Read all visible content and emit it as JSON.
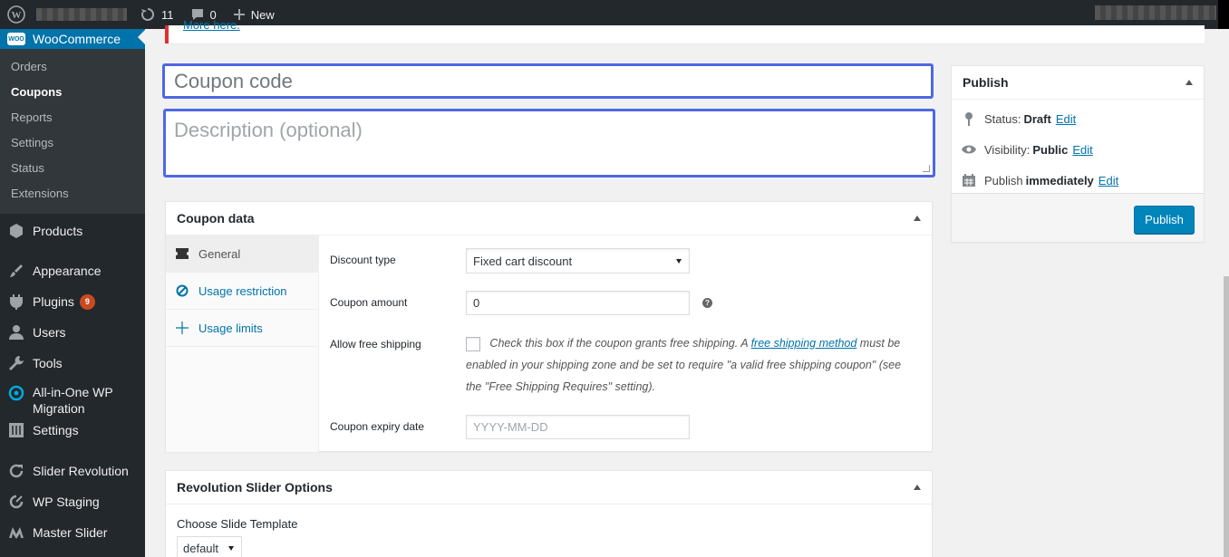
{
  "adminbar": {
    "updates_count": "11",
    "comments_count": "0",
    "new_label": "New"
  },
  "sidebar": {
    "woocommerce_label": "WooCommerce",
    "woo_badge": "WOO",
    "submenu": [
      "Orders",
      "Coupons",
      "Reports",
      "Settings",
      "Status",
      "Extensions"
    ],
    "items": [
      {
        "label": "Products"
      },
      {
        "label": "Appearance"
      },
      {
        "label": "Plugins",
        "badge": "9"
      },
      {
        "label": "Users"
      },
      {
        "label": "Tools"
      },
      {
        "label": "All-in-One WP Migration"
      },
      {
        "label": "Settings"
      },
      {
        "label": "Slider Revolution"
      },
      {
        "label": "WP Staging"
      },
      {
        "label": "Master Slider"
      }
    ]
  },
  "notice": {
    "link_text": "More here."
  },
  "coupon_form": {
    "code_placeholder": "Coupon code",
    "description_placeholder": "Description (optional)"
  },
  "coupon_data": {
    "title": "Coupon data",
    "tabs": [
      "General",
      "Usage restriction",
      "Usage limits"
    ],
    "discount_type_label": "Discount type",
    "discount_type_value": "Fixed cart discount",
    "coupon_amount_label": "Coupon amount",
    "coupon_amount_value": "0",
    "free_shipping_label": "Allow free shipping",
    "free_shipping_text_1": "Check this box if the coupon grants free shipping. A",
    "free_shipping_link": "free shipping method",
    "free_shipping_text_2": "must be enabled in your shipping zone and be set to require \"a valid free shipping coupon\" (see the \"Free Shipping Requires\" setting).",
    "expiry_label": "Coupon expiry date",
    "expiry_placeholder": "YYYY-MM-DD"
  },
  "revolution": {
    "title": "Revolution Slider Options",
    "template_label": "Choose Slide Template",
    "template_value": "default"
  },
  "publish": {
    "title": "Publish",
    "status_label": "Status:",
    "status_value": "Draft",
    "visibility_label": "Visibility:",
    "visibility_value": "Public",
    "publish_label": "Publish",
    "publish_value": "immediately",
    "edit_label": "Edit",
    "button_label": "Publish"
  },
  "colors": {
    "accent": "#0073aa",
    "highlight_border": "#4f67e6",
    "sidebar_bg": "#23282d"
  }
}
